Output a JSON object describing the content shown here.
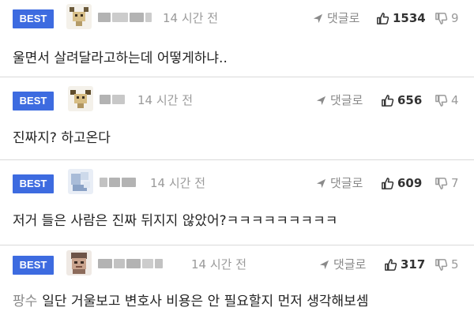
{
  "comments": [
    {
      "badge": "BEST",
      "time": "14 시간 전",
      "reply_label": "댓글로",
      "likes": "1534",
      "dislikes": "9",
      "text": "울면서 살려달라고하는데 어떻게하냐.."
    },
    {
      "badge": "BEST",
      "time": "14 시간 전",
      "reply_label": "댓글로",
      "likes": "656",
      "dislikes": "4",
      "text": "진짜지? 하고온다"
    },
    {
      "badge": "BEST",
      "time": "14 시간 전",
      "reply_label": "댓글로",
      "likes": "609",
      "dislikes": "7",
      "text": "저거 들은 사람은 진짜 뒤지지 않았어?ㅋㅋㅋㅋㅋㅋㅋㅋㅋ"
    },
    {
      "badge": "BEST",
      "time": "14 시간 전",
      "reply_label": "댓글로",
      "likes": "317",
      "dislikes": "5",
      "tag": "팡수",
      "text": "일단 거울보고 변호사 비용은 안 필요할지 먼저 생각해보셈"
    }
  ],
  "colors": {
    "badge": "#3d6be0",
    "divider": "#d9d9d9",
    "muted": "#9a9a9a"
  }
}
